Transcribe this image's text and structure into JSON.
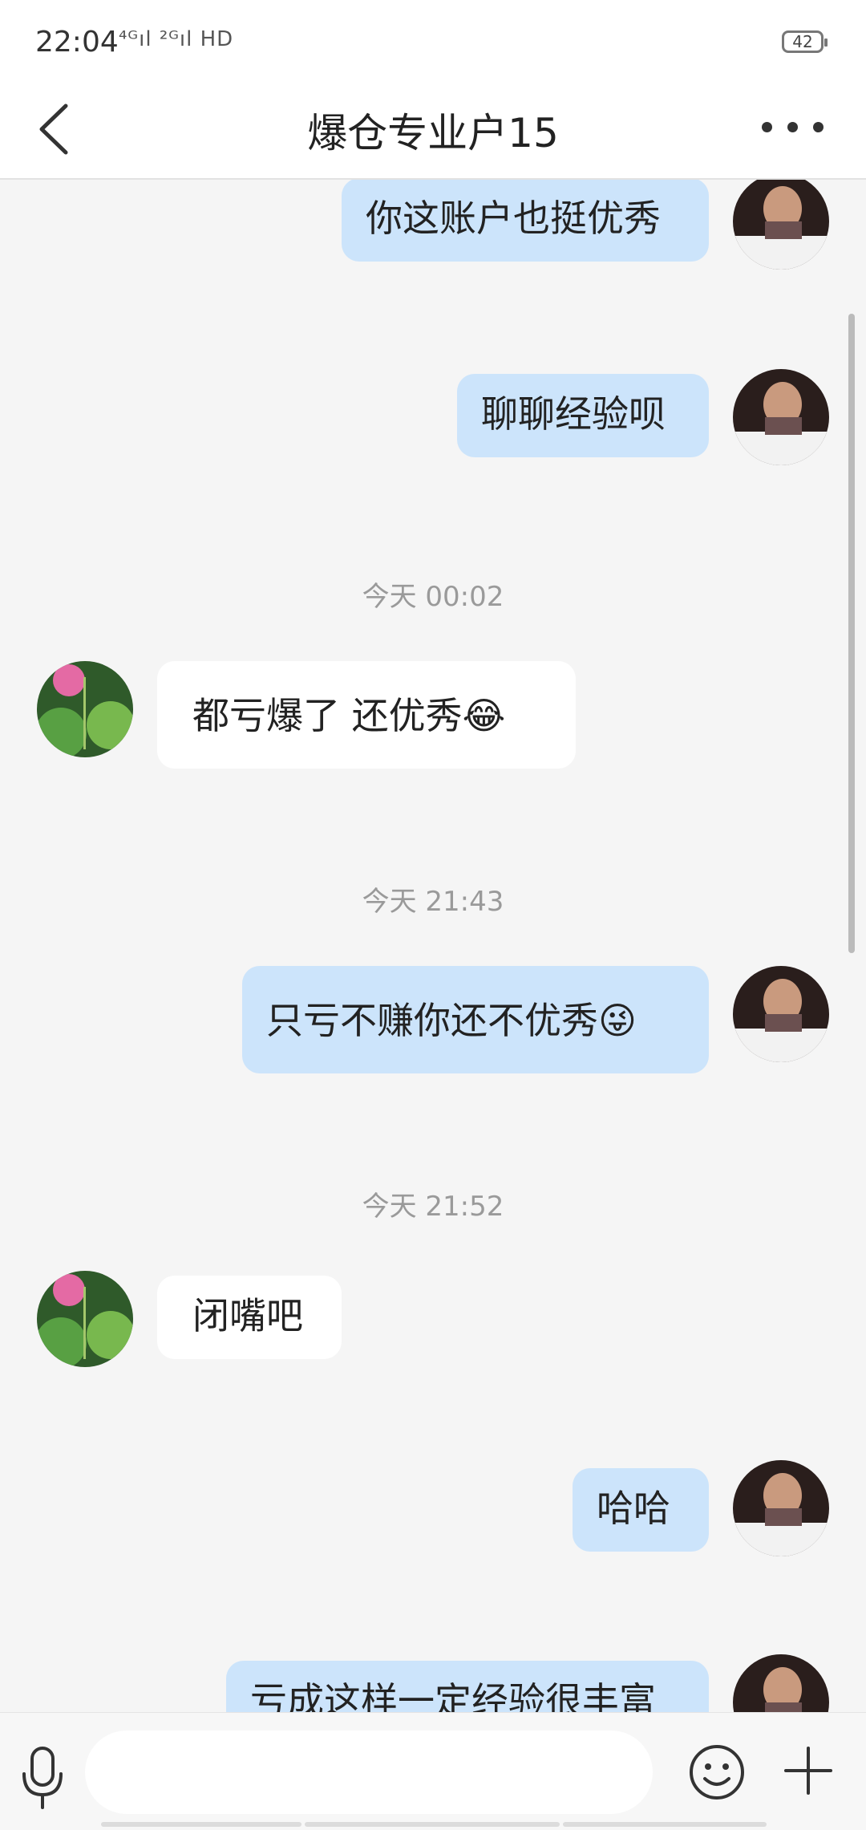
{
  "status_bar": {
    "time": "22:04",
    "signal": "⁴ᴳıl ²ᴳıl HD",
    "battery": "42"
  },
  "header": {
    "title": "爆仓专业户15"
  },
  "messages": [
    {
      "sender": "me",
      "text": "你这账户也挺优秀",
      "emoji": ""
    },
    {
      "sender": "me",
      "text": "聊聊经验呗",
      "emoji": ""
    },
    {
      "type": "time",
      "text": "今天 00:02"
    },
    {
      "sender": "them",
      "text": "都亏爆了   还优秀",
      "emoji": "😂"
    },
    {
      "type": "time",
      "text": "今天 21:43"
    },
    {
      "sender": "me",
      "text": "只亏不赚你还不优秀",
      "emoji": "😜"
    },
    {
      "type": "time",
      "text": "今天 21:52"
    },
    {
      "sender": "them",
      "text": "闭嘴吧",
      "emoji": ""
    },
    {
      "sender": "me",
      "text": "哈哈",
      "emoji": ""
    },
    {
      "sender": "me",
      "text": "亏成这样一定经验很丰富",
      "emoji": ""
    }
  ],
  "input": {
    "value": "",
    "placeholder": ""
  },
  "icons": {
    "back": "back-arrow-icon",
    "more": "more-dots-icon",
    "mic": "microphone-icon",
    "emoji": "emoji-icon",
    "plus": "plus-icon"
  },
  "colors": {
    "my_bubble": "#cce4fb",
    "their_bubble": "#ffffff",
    "background": "#f5f5f5"
  }
}
